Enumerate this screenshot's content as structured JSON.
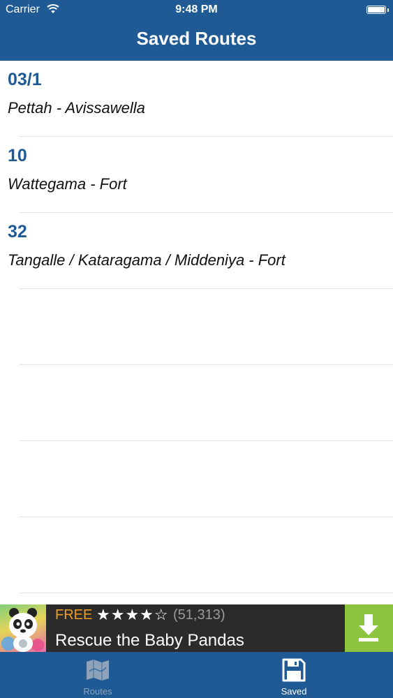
{
  "status_bar": {
    "carrier": "Carrier",
    "time": "9:48 PM"
  },
  "nav": {
    "title": "Saved Routes"
  },
  "routes": [
    {
      "number": "03/1",
      "name": "Pettah - Avissawella"
    },
    {
      "number": "10",
      "name": "Wattegama - Fort"
    },
    {
      "number": "32",
      "name": "Tangalle / Kataragama / Middeniya - Fort"
    }
  ],
  "ad": {
    "free_label": "FREE",
    "stars": "★★★★☆",
    "rating_count": "(51,313)",
    "title": "Rescue the Baby Pandas"
  },
  "tabs": {
    "routes_label": "Routes",
    "saved_label": "Saved"
  },
  "colors": {
    "primary": "#1f5a94",
    "ad_background": "#2b2b2b",
    "ad_free": "#f39c1e",
    "download_button": "#8dc43e"
  }
}
